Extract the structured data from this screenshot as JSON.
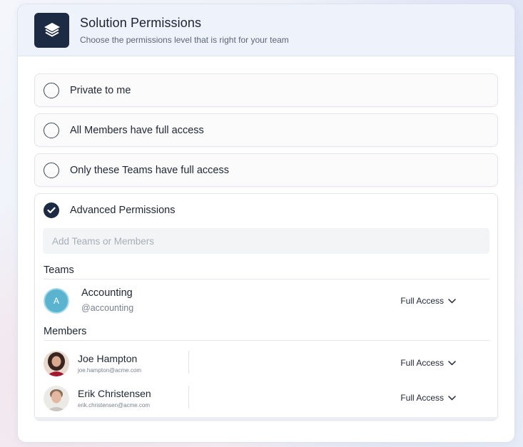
{
  "header": {
    "title": "Solution Permissions",
    "subtitle": "Choose the permissions level that is right for your team",
    "icon": "layers-icon"
  },
  "options": [
    {
      "label": "Private to me",
      "selected": false
    },
    {
      "label": "All Members have full access",
      "selected": false
    },
    {
      "label": "Only these Teams have full access",
      "selected": false
    },
    {
      "label": "Advanced Permissions",
      "selected": true
    }
  ],
  "advanced": {
    "search_placeholder": "Add Teams or Members",
    "search_value": "",
    "teams_title": "Teams",
    "members_title": "Members",
    "teams": [
      {
        "initial": "A",
        "name": "Accounting",
        "handle": "@accounting",
        "access": "Full Access"
      }
    ],
    "members": [
      {
        "name": "Joe Hampton",
        "email": "joe.hampton@acme.com",
        "access": "Full Access"
      },
      {
        "name": "Erik Christensen",
        "email": "erik.christensen@acme.com",
        "access": "Full Access"
      }
    ]
  },
  "colors": {
    "accent": "#1d2a44",
    "team_avatar": "#5bb4cf",
    "header_bg": "#eef2fa"
  }
}
